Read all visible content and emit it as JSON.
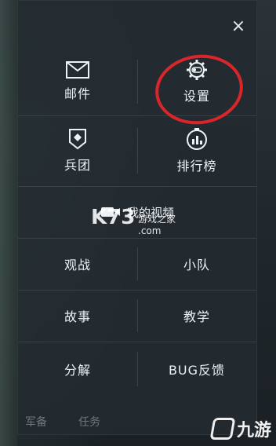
{
  "menu": {
    "close_label": "×",
    "items": [
      {
        "label": "邮件",
        "icon": "mail-icon"
      },
      {
        "label": "设置",
        "icon": "gear-icon"
      },
      {
        "label": "兵团",
        "icon": "legion-icon"
      },
      {
        "label": "排行榜",
        "icon": "leaderboard-icon"
      }
    ],
    "video_label": "我的视频",
    "text_items": [
      {
        "label": "观战"
      },
      {
        "label": "小队"
      },
      {
        "label": "故事"
      },
      {
        "label": "教学"
      },
      {
        "label": "分解"
      },
      {
        "label": "BUG反馈"
      }
    ]
  },
  "bottom_tabs": [
    "军备",
    "任务"
  ],
  "watermark": {
    "main": "K73",
    "sub": "游戏之家",
    "domain": ".com"
  },
  "corner_logo": "九游",
  "colors": {
    "highlight": "#d9262b",
    "panel": "#232a30",
    "text": "#eef2f4"
  }
}
